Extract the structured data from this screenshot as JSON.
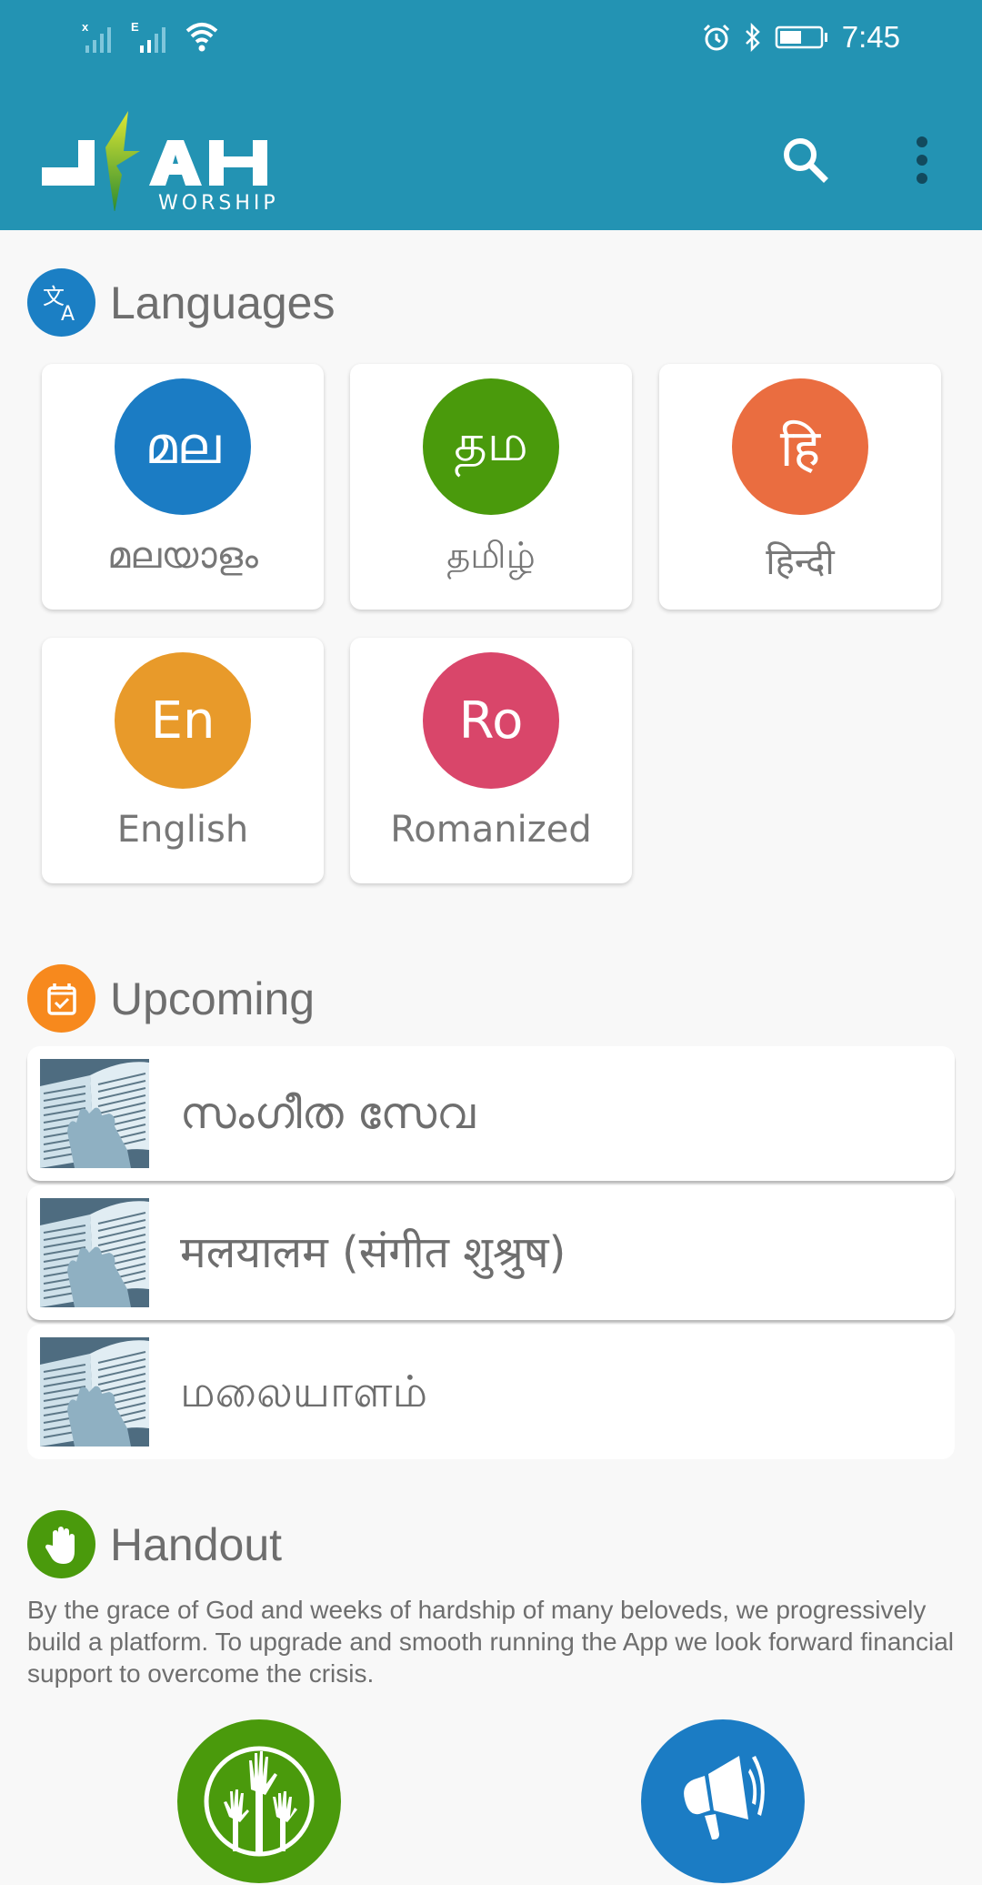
{
  "status_bar": {
    "sim1_label": "x",
    "sim2_label": "E",
    "time": "7:45",
    "battery_level_percent": 55
  },
  "app": {
    "logo_main": "JEAH",
    "logo_sub": "WORSHIP",
    "colors": {
      "primary": "#2393b3",
      "background": "#f8f8f8"
    }
  },
  "toolbar": {
    "search_icon": "search-icon",
    "menu_icon": "more-vertical-icon"
  },
  "languages": {
    "title": "Languages",
    "icon": "translate-icon",
    "icon_color": "#1b7fc4",
    "items": [
      {
        "abbr": "മല",
        "name": "മലയാളം",
        "color": "#1b7cc4"
      },
      {
        "abbr": "தம",
        "name": "தமிழ்",
        "color": "#4a9a0c"
      },
      {
        "abbr": "हि",
        "name": "हिन्दी",
        "color": "#ea6d40"
      },
      {
        "abbr": "En",
        "name": "English",
        "color": "#e89a2a"
      },
      {
        "abbr": "Ro",
        "name": "Romanized",
        "color": "#d9466a"
      }
    ]
  },
  "upcoming": {
    "title": "Upcoming",
    "icon": "calendar-check-icon",
    "icon_color": "#f7891d",
    "items": [
      {
        "title": "സംഗീത സേവ",
        "thumb": "open-book-thumbnail"
      },
      {
        "title": "मलयालम (संगीत शुश्रुष)",
        "thumb": "open-book-thumbnail"
      },
      {
        "title": "மலையாளம்",
        "thumb": "open-book-thumbnail"
      }
    ]
  },
  "handout": {
    "title": "Handout",
    "icon": "hand-icon",
    "icon_color": "#4a9a0c",
    "text": "By the grace of God and weeks of hardship of many beloveds, we progressively build a platform. To upgrade and smooth running the App we look forward financial support to overcome the crisis.",
    "buttons": [
      {
        "icon": "raised-hands-icon",
        "color": "#4a9a0c"
      },
      {
        "icon": "megaphone-icon",
        "color": "#1b7cc4"
      }
    ]
  }
}
